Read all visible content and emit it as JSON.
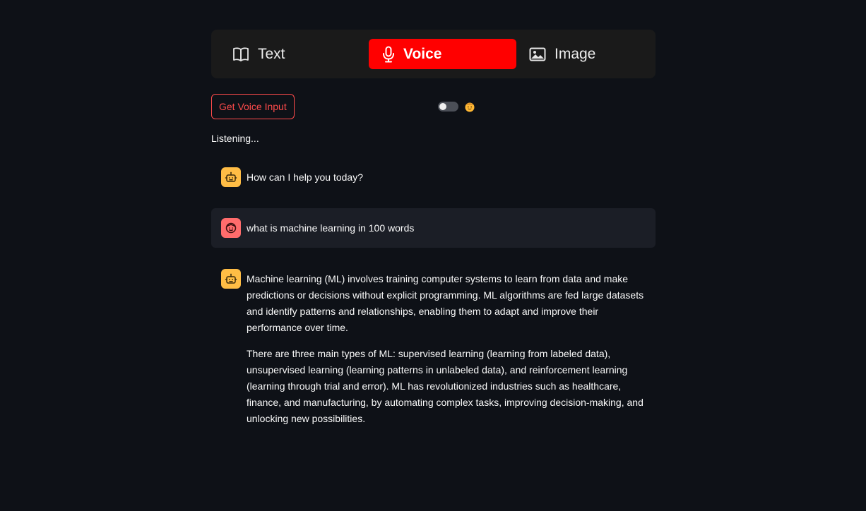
{
  "tabs": [
    {
      "label": "Text",
      "icon": "book-icon",
      "active": false
    },
    {
      "label": "Voice",
      "icon": "microphone-icon",
      "active": true
    },
    {
      "label": "Image",
      "icon": "image-icon",
      "active": false
    }
  ],
  "controls": {
    "voice_button_label": "Get Voice Input",
    "toggle_state": "off",
    "toggle_icon": "smiling-face-emoji-icon"
  },
  "status": "Listening...",
  "messages": [
    {
      "role": "assistant",
      "avatar_icon": "robot-icon",
      "paragraphs": [
        "How can I help you today?"
      ]
    },
    {
      "role": "user",
      "avatar_icon": "user-face-icon",
      "paragraphs": [
        "what is machine learning in 100 words"
      ]
    },
    {
      "role": "assistant",
      "avatar_icon": "robot-icon",
      "paragraphs": [
        "Machine learning (ML) involves training computer systems to learn from data and make predictions or decisions without explicit programming. ML algorithms are fed large datasets and identify patterns and relationships, enabling them to adapt and improve their performance over time.",
        "There are three main types of ML: supervised learning (learning from labeled data), unsupervised learning (learning patterns in unlabeled data), and reinforcement learning (learning through trial and error). ML has revolutionized industries such as healthcare, finance, and manufacturing, by automating complex tasks, improving decision-making, and unlocking new possibilities."
      ]
    }
  ],
  "colors": {
    "background": "#0e1117",
    "tab_bar": "#1a1a1a",
    "active_tab": "#ff0000",
    "button_accent": "#ff4b4b",
    "assistant_avatar": "#ffbd45",
    "user_avatar": "#ff6c6c",
    "user_message_bg": "#1b1e26"
  }
}
